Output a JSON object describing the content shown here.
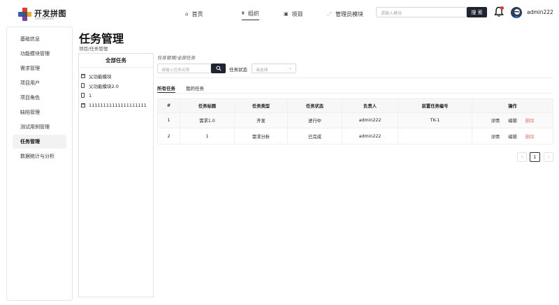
{
  "brand": {
    "name": "开发拼图",
    "subtitle": "DevMosaic"
  },
  "nav": [
    {
      "label": "首页",
      "icon": "home-icon"
    },
    {
      "label": "组织",
      "icon": "org-icon"
    },
    {
      "label": "项目",
      "icon": "project-icon"
    },
    {
      "label": "管理员模块",
      "icon": "admin-icon"
    }
  ],
  "header": {
    "search_placeholder": "请输入模块",
    "search_button": "搜 索",
    "username": "admin222"
  },
  "sidebar": {
    "items": [
      {
        "label": "基础信息"
      },
      {
        "label": "功能模块管理"
      },
      {
        "label": "需求管理"
      },
      {
        "label": "项目用户"
      },
      {
        "label": "项目角色"
      },
      {
        "label": "缺陷管理"
      },
      {
        "label": "测试用例管理"
      },
      {
        "label": "任务管理"
      },
      {
        "label": "数据统计与分析"
      }
    ]
  },
  "page": {
    "title": "任务管理",
    "breadcrumb": "项目/任务管理"
  },
  "tree": {
    "title": "全部任务",
    "nodes": [
      {
        "label": "父功能模块"
      },
      {
        "label": "父功能模块2.0"
      },
      {
        "label": "1"
      },
      {
        "label": "11111111111111111111"
      }
    ]
  },
  "content": {
    "breadcrumb": "任务管理/全部任务",
    "search_placeholder": "请输入任务名称",
    "status_label": "任务状态",
    "status_placeholder": "请选择",
    "tabs": [
      {
        "label": "所有任务"
      },
      {
        "label": "我的任务"
      }
    ]
  },
  "table": {
    "headers": [
      "#",
      "任务标题",
      "任务类型",
      "任务状态",
      "负责人",
      "前置任务编号",
      "操作"
    ],
    "rows": [
      {
        "no": "1",
        "title": "需求1.0",
        "type": "开发",
        "status": "进行中",
        "owner": "admin222",
        "prev": "TK-1"
      },
      {
        "no": "2",
        "title": "1",
        "type": "需求分析",
        "status": "已完成",
        "owner": "admin222",
        "prev": ""
      }
    ],
    "ops": {
      "detail": "详情",
      "edit": "编辑",
      "delete": "删除"
    }
  },
  "pagination": {
    "current": "1",
    "prev": "‹",
    "next": "›"
  },
  "colors": {
    "primary": "#1f2430",
    "danger": "#e57373",
    "bell_dot": "#e53935"
  }
}
